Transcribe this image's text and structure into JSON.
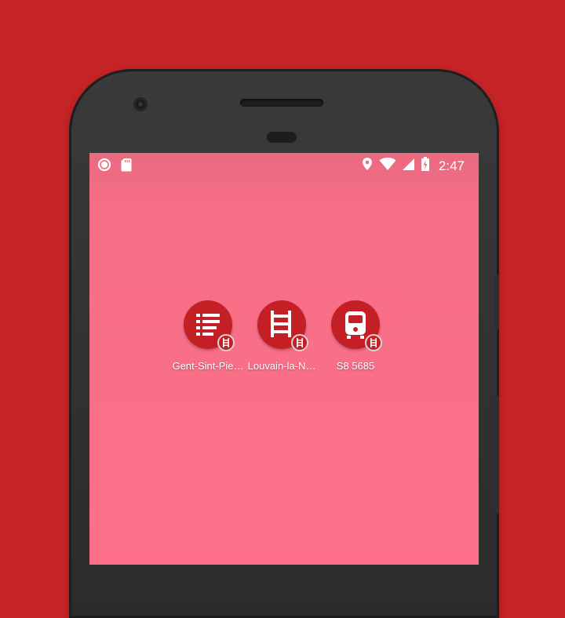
{
  "status_bar": {
    "time": "2:47",
    "left_icons": [
      "circle-notification-icon",
      "sd-card-icon"
    ],
    "right_icons": [
      "location-icon",
      "wifi-icon",
      "cell-signal-icon",
      "battery-charging-icon"
    ]
  },
  "home": {
    "shortcuts": [
      {
        "label": "Gent-Sint-Pie…",
        "icon": "departures-list-icon"
      },
      {
        "label": "Louvain-la-N…",
        "icon": "railway-track-icon"
      },
      {
        "label": "S8 5685",
        "icon": "train-icon"
      }
    ]
  },
  "colors": {
    "background": "#c62426",
    "screen": "#ff6f8a",
    "shortcut": "#c41f24"
  }
}
